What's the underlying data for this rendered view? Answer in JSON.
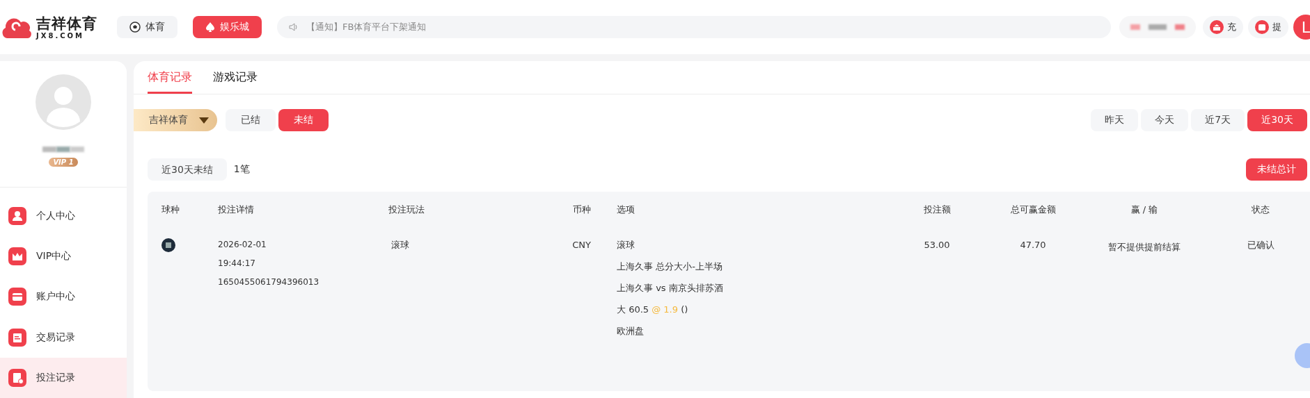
{
  "logo": {
    "name": "吉祥体育",
    "domain": "JX8.COM"
  },
  "nav": [
    {
      "label": "体育",
      "kind": "sport",
      "selected": false
    },
    {
      "label": "娱乐城",
      "kind": "casino",
      "selected": true
    }
  ],
  "notice": "【通知】FB体育平台下架通知",
  "wallet": [
    {
      "label": "充",
      "kind": "deposit"
    },
    {
      "label": "提",
      "kind": "withdraw"
    }
  ],
  "user": {
    "initial": "L",
    "vip_badge": "VIP 1"
  },
  "sidebar": [
    {
      "label": "个人中心",
      "kind": "person",
      "selected": false
    },
    {
      "label": "VIP中心",
      "kind": "crown",
      "selected": false
    },
    {
      "label": "账户中心",
      "kind": "card",
      "selected": false
    },
    {
      "label": "交易记录",
      "kind": "receipt",
      "selected": false
    },
    {
      "label": "投注记录",
      "kind": "betslip",
      "selected": true
    }
  ],
  "tabs": [
    {
      "label": "体育记录",
      "selected": true
    },
    {
      "label": "游戏记录",
      "selected": false
    }
  ],
  "platform": "吉祥体育",
  "status_filters": [
    {
      "label": "已结",
      "selected": false
    },
    {
      "label": "未结",
      "selected": true
    }
  ],
  "date_filters": [
    {
      "label": "昨天",
      "selected": false
    },
    {
      "label": "今天",
      "selected": false
    },
    {
      "label": "近7天",
      "selected": false
    },
    {
      "label": "近30天",
      "selected": true
    }
  ],
  "summary": {
    "label": "近30天未结",
    "count": "1笔",
    "button": "未结总计"
  },
  "table": {
    "columns": [
      "球种",
      "投注详情",
      "投注玩法",
      "币种",
      "选项",
      "投注额",
      "总可赢金额",
      "赢 / 输",
      "状态"
    ],
    "rows": [
      {
        "date": "2026-02-01",
        "time": "19:44:17",
        "order_no": "1650455061794396013",
        "play": "滚球",
        "currency": "CNY",
        "option": {
          "type": "滚球",
          "market": "上海久事 总分大小-上半场",
          "match": "上海久事 vs 南京头排苏酒",
          "pick": "大 60.5",
          "odds": "@ 1.9",
          "extra": "()",
          "odds_format": "欧洲盘"
        },
        "stake": "53.00",
        "payout": "47.70",
        "result": "暂不提供提前结算",
        "status": "已确认"
      }
    ]
  }
}
